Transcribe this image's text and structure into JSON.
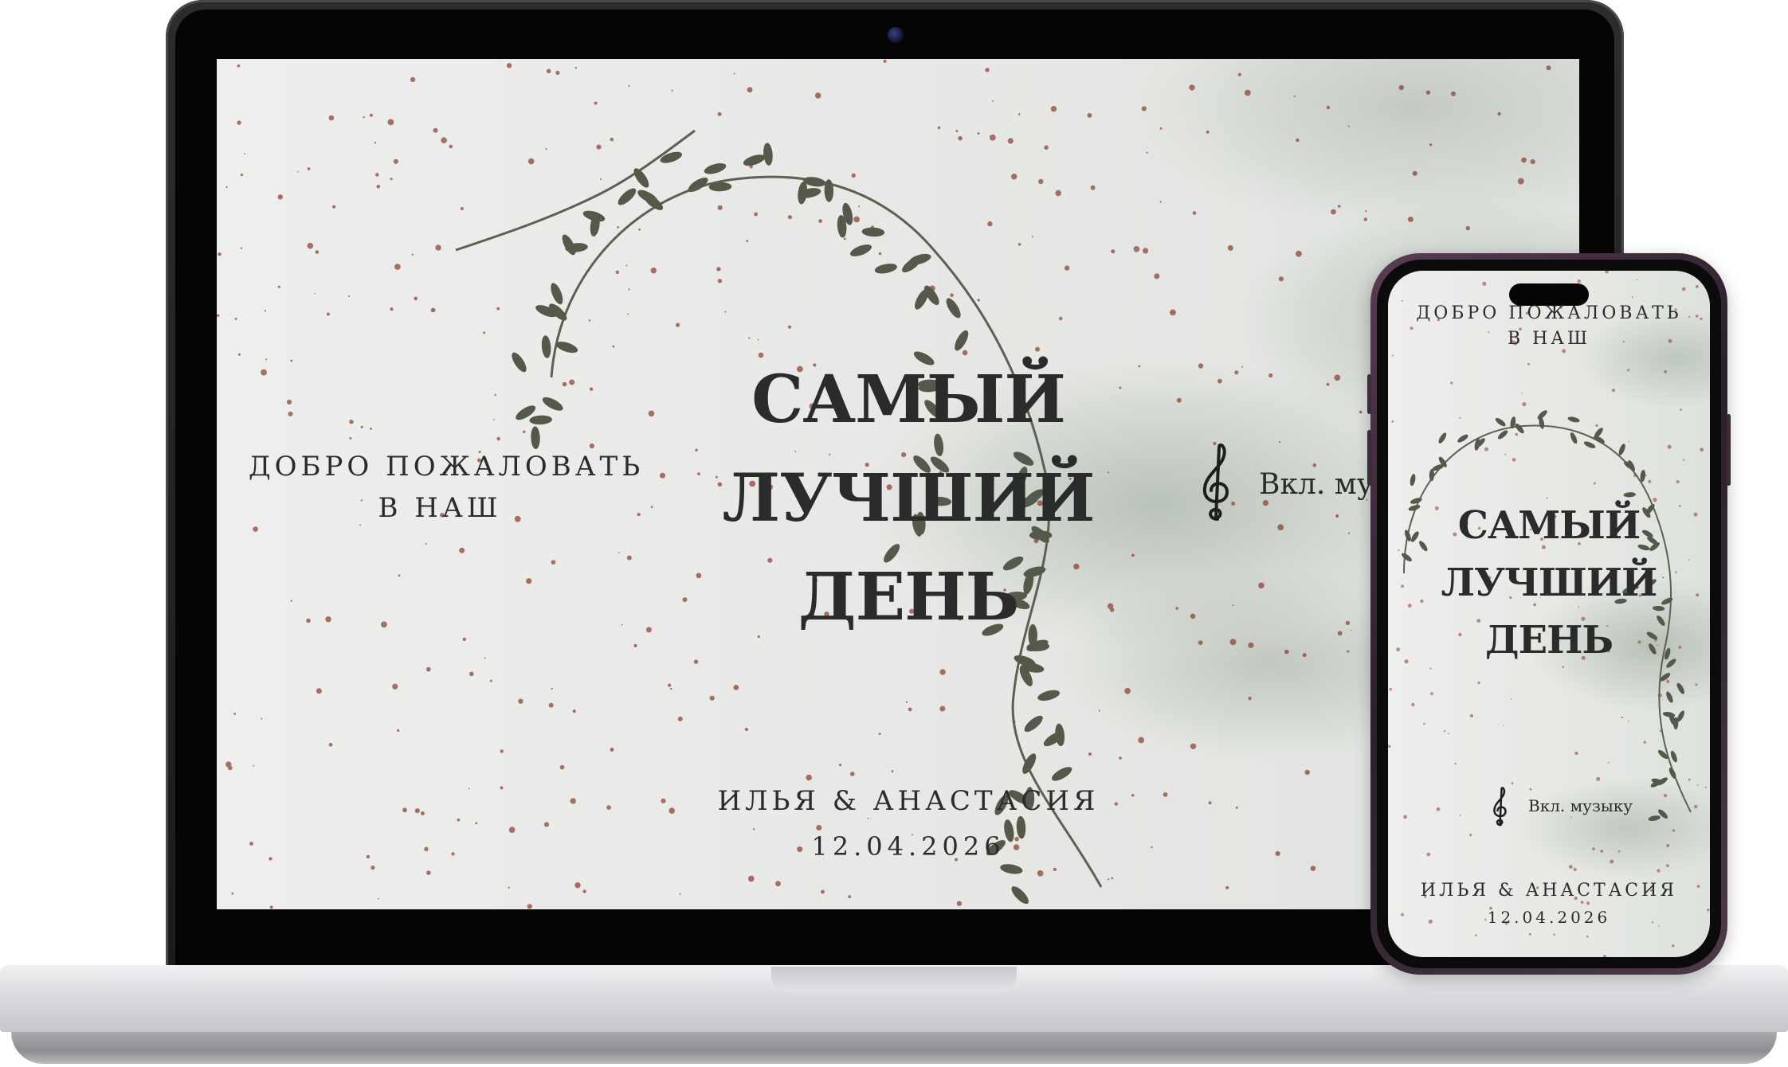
{
  "desktop": {
    "welcome_line1": "ДОБРО ПОЖАЛОВАТЬ",
    "welcome_line2": "В НАШ",
    "title_line1": "САМЫЙ",
    "title_line2": "ЛУЧШИЙ",
    "title_line3": "ДЕНЬ",
    "music_label": "Вкл. му",
    "names": "ИЛЬЯ & АНАСТАСИЯ",
    "date": "12.04.2026"
  },
  "mobile": {
    "welcome_line1": "ДОБРО ПОЖАЛОВАТЬ",
    "welcome_line2": "В НАШ",
    "title_line1": "САМЫЙ",
    "title_line2": "ЛУЧШИЙ",
    "title_line3": "ДЕНЬ",
    "music_label": "Вкл. музыку",
    "names": "ИЛЬЯ & АНАСТАСИЯ",
    "date": "12.04.2026"
  },
  "icons": {
    "music": "treble-clef-icon",
    "decoration": "leaf-vine-wreath"
  },
  "colors": {
    "text": "#2a2b2b",
    "leaves": "#55594a",
    "speckles": "#8a3b2c",
    "phone_frame": "#4d3a4a"
  }
}
